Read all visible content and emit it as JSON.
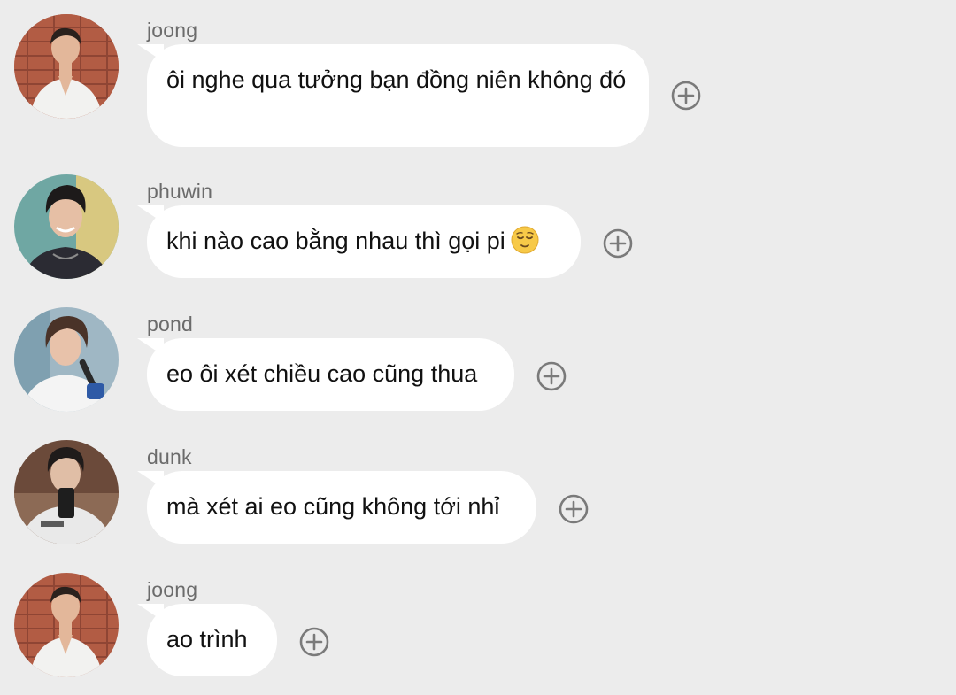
{
  "messages": [
    {
      "sender": "joong",
      "text": "ôi nghe qua tưởng bạn đồng niên không đó",
      "emoji": ""
    },
    {
      "sender": "phuwin",
      "text": "khi nào cao bằng nhau thì gọi pi",
      "emoji": "relieved-face"
    },
    {
      "sender": "pond",
      "text": "eo ôi xét chiều cao cũng thua",
      "emoji": ""
    },
    {
      "sender": "dunk",
      "text": "mà xét ai eo cũng không tới nhỉ",
      "emoji": ""
    },
    {
      "sender": "joong",
      "text": "ao trình",
      "emoji": ""
    }
  ],
  "icons": {
    "add_reaction": "plus-circle-icon"
  },
  "colors": {
    "background": "#ececec",
    "bubble": "#ffffff",
    "sender_text": "#6b6b6b",
    "icon": "#7a7a7a"
  }
}
